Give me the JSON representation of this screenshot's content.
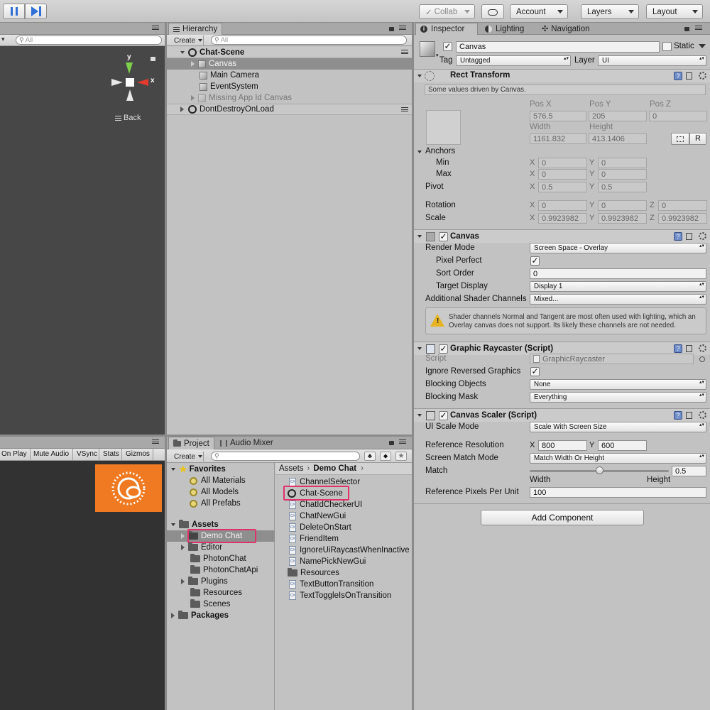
{
  "toolbar": {
    "collab": "Collab",
    "account": "Account",
    "layers": "Layers",
    "layout": "Layout"
  },
  "scene": {
    "search_placeholder": "All",
    "gizmo_y": "y",
    "gizmo_x": "x",
    "back_label": "Back"
  },
  "game": {
    "buttons": [
      "On Play",
      "Mute Audio",
      "VSync",
      "Stats",
      "Gizmos"
    ]
  },
  "hierarchy": {
    "tab": "Hierarchy",
    "create": "Create",
    "search_placeholder": "All",
    "items": [
      {
        "label": "Chat-Scene"
      },
      {
        "label": "Canvas"
      },
      {
        "label": "Main Camera"
      },
      {
        "label": "EventSystem"
      },
      {
        "label": "Missing App Id Canvas"
      },
      {
        "label": "DontDestroyOnLoad"
      }
    ]
  },
  "project": {
    "tabs": [
      "Project",
      "Audio Mixer"
    ],
    "create": "Create",
    "favorites": {
      "label": "Favorites",
      "items": [
        "All Materials",
        "All Models",
        "All Prefabs"
      ]
    },
    "assets": {
      "label": "Assets",
      "items": [
        "Demo Chat",
        "Editor",
        "PhotonChat",
        "PhotonChatApi",
        "Plugins",
        "Resources",
        "Scenes"
      ]
    },
    "packages": "Packages",
    "breadcrumb": [
      "Assets",
      "Demo Chat"
    ],
    "files": [
      "ChannelSelector",
      "Chat-Scene",
      "ChatIdCheckerUI",
      "ChatNewGui",
      "DeleteOnStart",
      "FriendItem",
      "IgnoreUiRaycastWhenInactive",
      "NamePickNewGui",
      "Resources",
      "TextButtonTransition",
      "TextToggleIsOnTransition"
    ]
  },
  "inspector": {
    "tabs": [
      "Inspector",
      "Lighting",
      "Navigation"
    ],
    "object_name": "Canvas",
    "static_label": "Static",
    "tag_label": "Tag",
    "tag_value": "Untagged",
    "layer_label": "Layer",
    "layer_value": "UI",
    "rect": {
      "title": "Rect Transform",
      "note": "Some values driven by Canvas.",
      "pos_x_label": "Pos X",
      "pos_y_label": "Pos Y",
      "pos_z_label": "Pos Z",
      "pos_x": "576.5",
      "pos_y": "205",
      "pos_z": "0",
      "width_label": "Width",
      "height_label": "Height",
      "width": "1161.832",
      "height": "413.1406",
      "r_button": "R",
      "anchors": "Anchors",
      "min": "Min",
      "max": "Max",
      "min_x": "0",
      "min_y": "0",
      "max_x": "0",
      "max_y": "0",
      "pivot": "Pivot",
      "pivot_x": "0.5",
      "pivot_y": "0.5",
      "rotation": "Rotation",
      "rot_x": "0",
      "rot_y": "0",
      "rot_z": "0",
      "scale": "Scale",
      "scale_x": "0.9923982",
      "scale_y": "0.9923982",
      "scale_z": "0.9923982",
      "x": "X",
      "y": "Y",
      "z": "Z"
    },
    "canvas": {
      "title": "Canvas",
      "render_mode_label": "Render Mode",
      "render_mode": "Screen Space - Overlay",
      "pixel_perfect_label": "Pixel Perfect",
      "sort_order_label": "Sort Order",
      "sort_order": "0",
      "target_display_label": "Target Display",
      "target_display": "Display 1",
      "shader_channels_label": "Additional Shader Channels",
      "shader_channels": "Mixed...",
      "warning": "Shader channels Normal and Tangent are most often used with lighting, which an Overlay canvas does not support. Its likely these channels are not needed."
    },
    "raycaster": {
      "title": "Graphic Raycaster (Script)",
      "script_label": "Script",
      "script_value": "GraphicRaycaster",
      "ignore_label": "Ignore Reversed Graphics",
      "blocking_objects_label": "Blocking Objects",
      "blocking_objects": "None",
      "blocking_mask_label": "Blocking Mask",
      "blocking_mask": "Everything"
    },
    "scaler": {
      "title": "Canvas Scaler (Script)",
      "ui_scale_label": "UI Scale Mode",
      "ui_scale": "Scale With Screen Size",
      "ref_res_label": "Reference Resolution",
      "ref_x": "800",
      "ref_y": "600",
      "match_mode_label": "Screen Match Mode",
      "match_mode": "Match Width Or Height",
      "match_label": "Match",
      "match_value": "0.5",
      "match_fraction": 0.5,
      "width_label": "Width",
      "height_label": "Height",
      "ref_ppu_label": "Reference Pixels Per Unit",
      "ref_ppu": "100"
    },
    "add_component": "Add Component"
  }
}
